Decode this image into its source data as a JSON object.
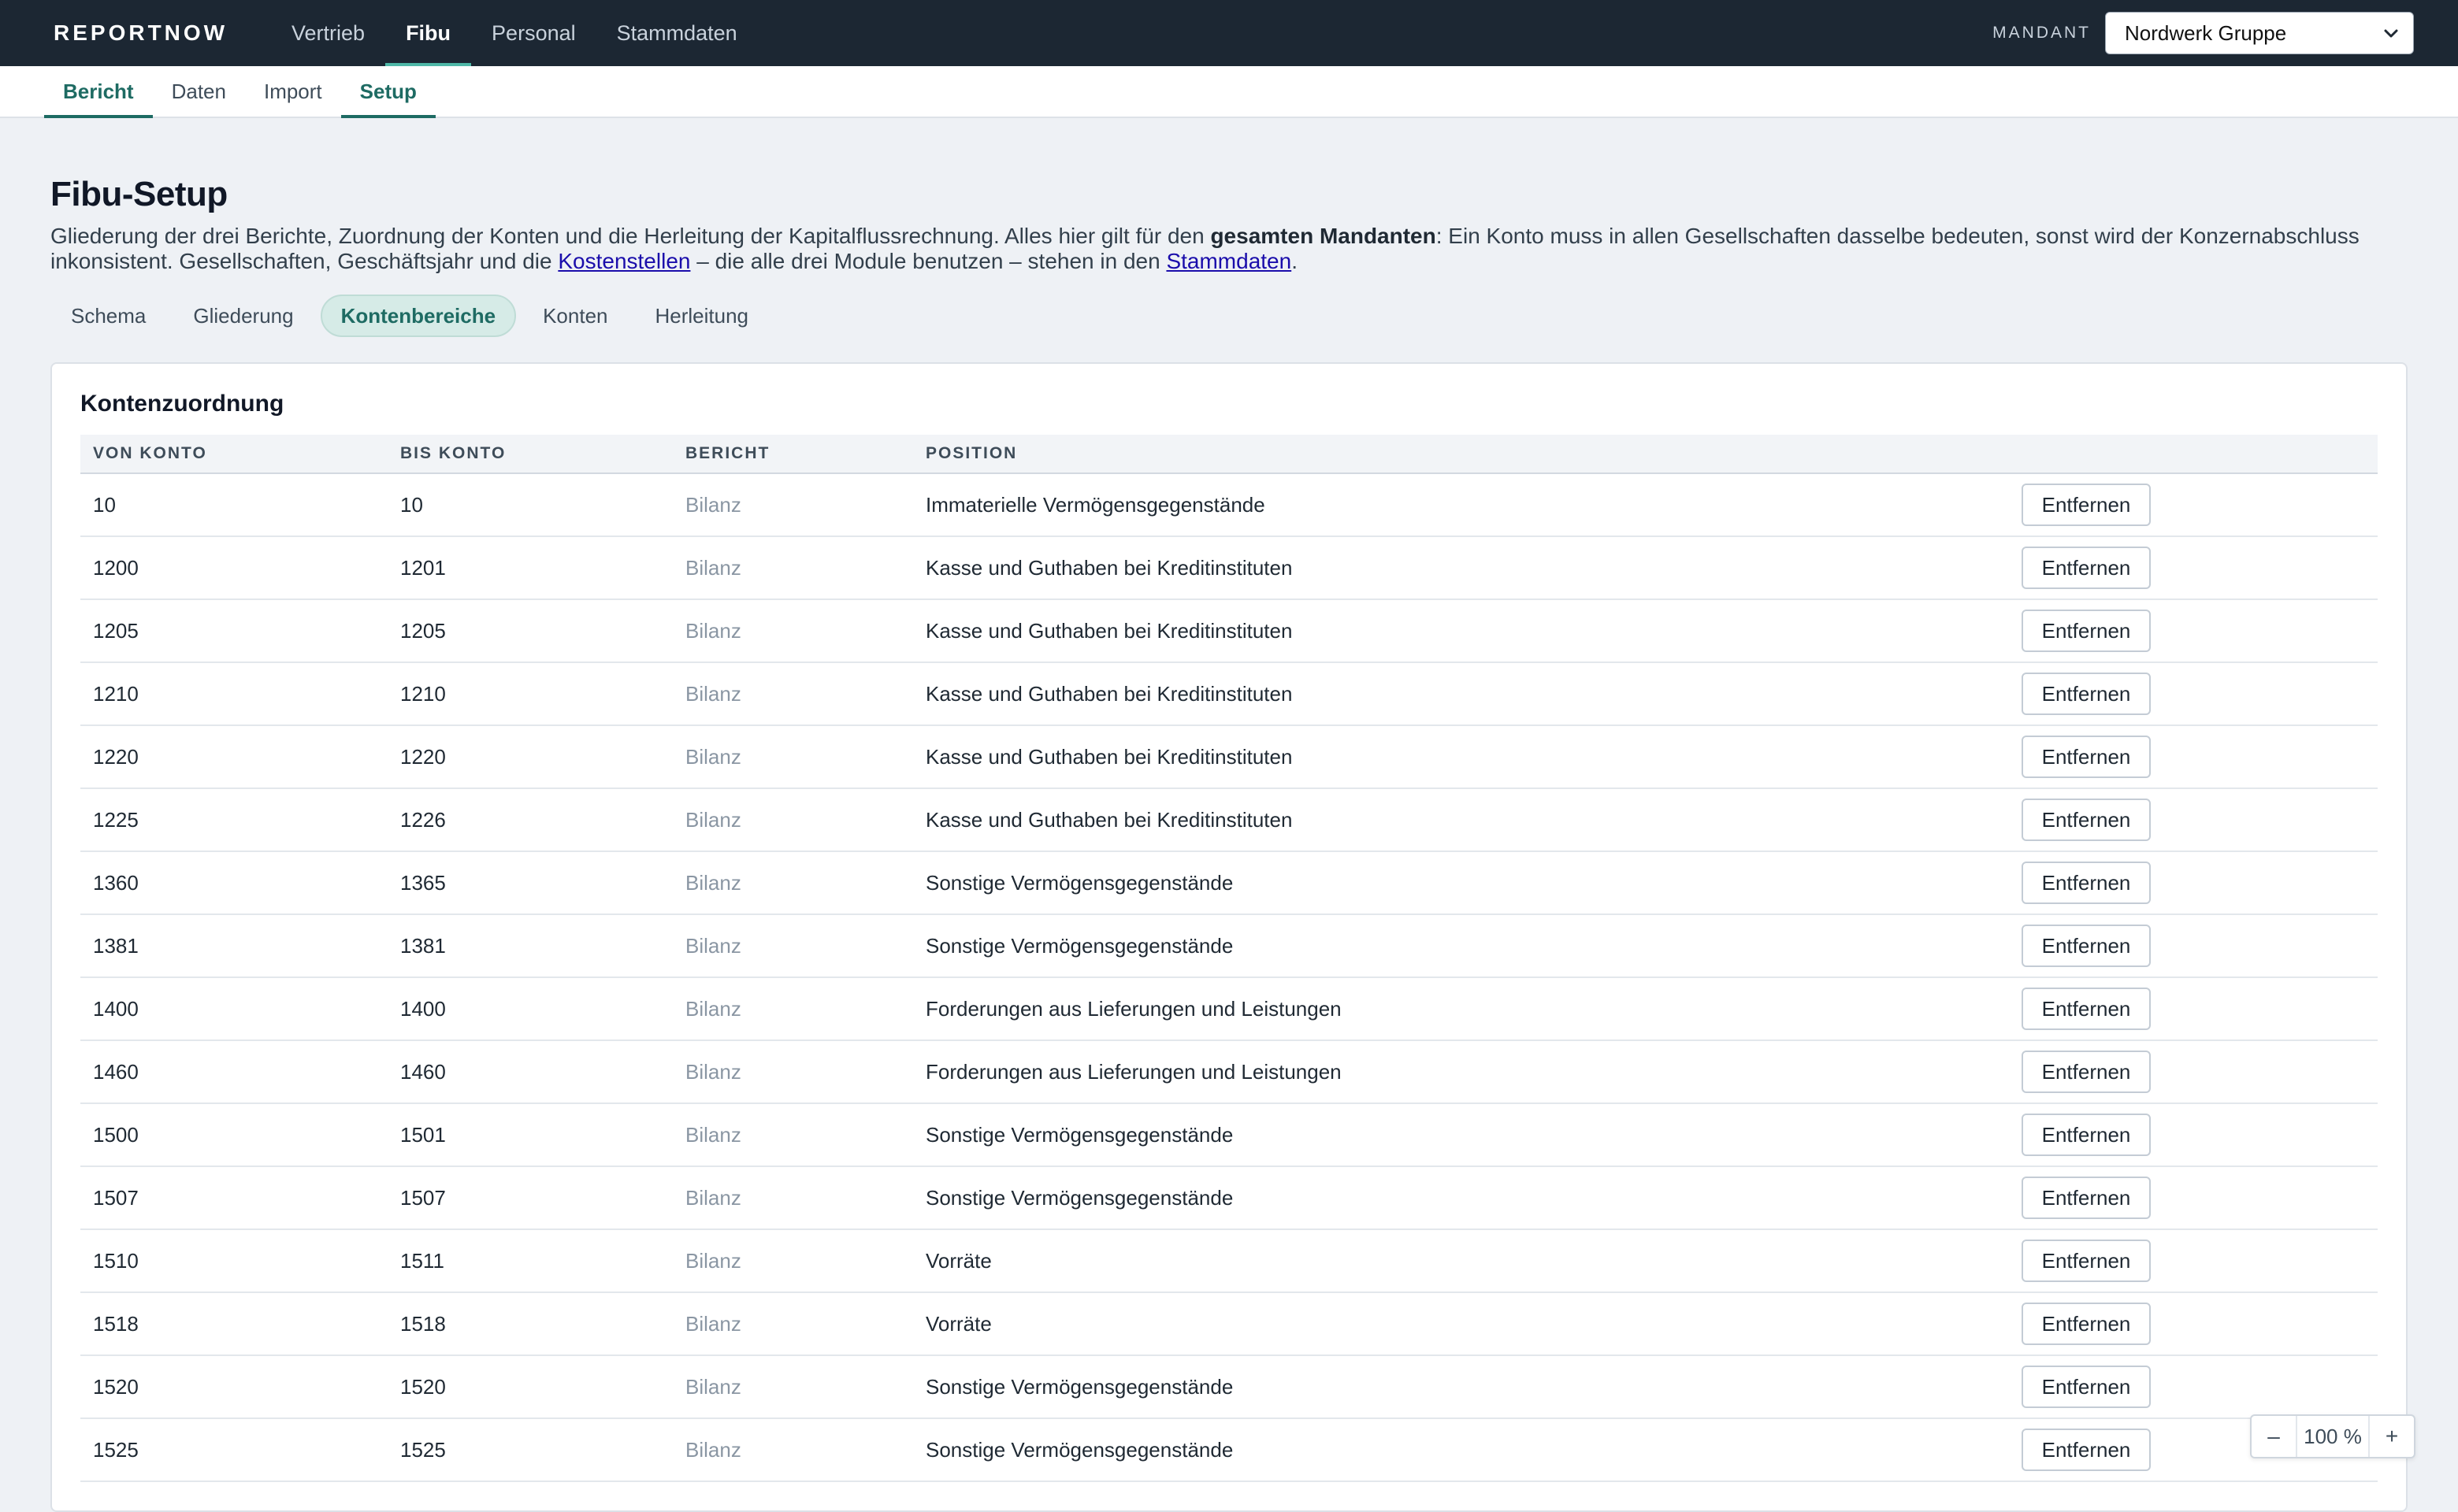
{
  "app": {
    "logo": "REPORTNOW"
  },
  "main_nav": [
    {
      "label": "Vertrieb",
      "active": false
    },
    {
      "label": "Fibu",
      "active": true
    },
    {
      "label": "Personal",
      "active": false
    },
    {
      "label": "Stammdaten",
      "active": false
    }
  ],
  "mandant": {
    "label": "MANDANT",
    "value": "Nordwerk Gruppe"
  },
  "sub_nav": [
    {
      "label": "Bericht",
      "active": true
    },
    {
      "label": "Daten",
      "active": false
    },
    {
      "label": "Import",
      "active": false
    },
    {
      "label": "Setup",
      "active": true
    }
  ],
  "page": {
    "title": "Fibu-Setup",
    "intro_1": "Gliederung der drei Berichte, Zuordnung der Konten und die Herleitung der Kapitalflussrechnung. Alles hier gilt für den ",
    "intro_bold": "gesamten Mandanten",
    "intro_2": ": Ein Konto muss in allen Gesellschaften dasselbe bedeuten, sonst wird der Konzernabschluss inkonsistent. Gesellschaften, Geschäftsjahr und die ",
    "intro_link1": "Kostenstellen",
    "intro_3": " – die alle drei Module benutzen – stehen in den ",
    "intro_link2": "Stammdaten",
    "intro_4": "."
  },
  "tabs": [
    {
      "label": "Schema",
      "active": false
    },
    {
      "label": "Gliederung",
      "active": false
    },
    {
      "label": "Kontenbereiche",
      "active": true
    },
    {
      "label": "Konten",
      "active": false
    },
    {
      "label": "Herleitung",
      "active": false
    }
  ],
  "card": {
    "title": "Kontenzuordnung",
    "columns": [
      "VON KONTO",
      "BIS KONTO",
      "BERICHT",
      "POSITION",
      ""
    ],
    "remove_label": "Entfernen",
    "rows": [
      {
        "von": "10",
        "bis": "10",
        "bericht": "Bilanz",
        "position": "Immaterielle Vermögensgegenstände"
      },
      {
        "von": "1200",
        "bis": "1201",
        "bericht": "Bilanz",
        "position": "Kasse und Guthaben bei Kreditinstituten"
      },
      {
        "von": "1205",
        "bis": "1205",
        "bericht": "Bilanz",
        "position": "Kasse und Guthaben bei Kreditinstituten"
      },
      {
        "von": "1210",
        "bis": "1210",
        "bericht": "Bilanz",
        "position": "Kasse und Guthaben bei Kreditinstituten"
      },
      {
        "von": "1220",
        "bis": "1220",
        "bericht": "Bilanz",
        "position": "Kasse und Guthaben bei Kreditinstituten"
      },
      {
        "von": "1225",
        "bis": "1226",
        "bericht": "Bilanz",
        "position": "Kasse und Guthaben bei Kreditinstituten"
      },
      {
        "von": "1360",
        "bis": "1365",
        "bericht": "Bilanz",
        "position": "Sonstige Vermögensgegenstände"
      },
      {
        "von": "1381",
        "bis": "1381",
        "bericht": "Bilanz",
        "position": "Sonstige Vermögensgegenstände"
      },
      {
        "von": "1400",
        "bis": "1400",
        "bericht": "Bilanz",
        "position": "Forderungen aus Lieferungen und Leistungen"
      },
      {
        "von": "1460",
        "bis": "1460",
        "bericht": "Bilanz",
        "position": "Forderungen aus Lieferungen und Leistungen"
      },
      {
        "von": "1500",
        "bis": "1501",
        "bericht": "Bilanz",
        "position": "Sonstige Vermögensgegenstände"
      },
      {
        "von": "1507",
        "bis": "1507",
        "bericht": "Bilanz",
        "position": "Sonstige Vermögensgegenstände"
      },
      {
        "von": "1510",
        "bis": "1511",
        "bericht": "Bilanz",
        "position": "Vorräte"
      },
      {
        "von": "1518",
        "bis": "1518",
        "bericht": "Bilanz",
        "position": "Vorräte"
      },
      {
        "von": "1520",
        "bis": "1520",
        "bericht": "Bilanz",
        "position": "Sonstige Vermögensgegenstände"
      },
      {
        "von": "1525",
        "bis": "1525",
        "bericht": "Bilanz",
        "position": "Sonstige Vermögensgegenstände"
      }
    ]
  },
  "zoom": {
    "minus": "–",
    "value": "100 %",
    "plus": "+"
  },
  "icons": {
    "mandant_chevron": "chevron-down-icon"
  }
}
